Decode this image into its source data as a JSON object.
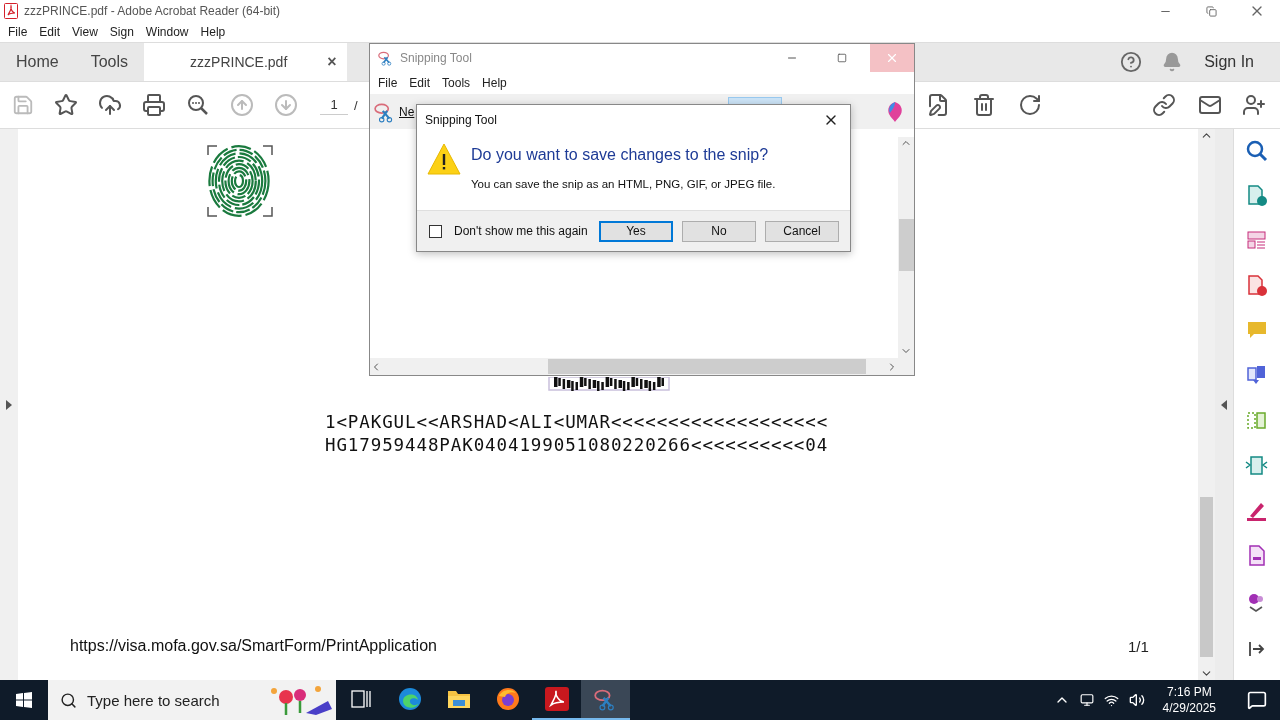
{
  "window": {
    "title": "zzzPRINCE.pdf - Adobe Acrobat Reader (64-bit)"
  },
  "menu": [
    "File",
    "Edit",
    "View",
    "Sign",
    "Window",
    "Help"
  ],
  "tabs": [
    {
      "label": "Home",
      "selected": false
    },
    {
      "label": "Tools",
      "selected": false
    },
    {
      "label": "zzzPRINCE.pdf",
      "selected": true,
      "close": "×"
    }
  ],
  "account": {
    "sign_in": "Sign In"
  },
  "toolbar": {
    "tools": [
      {
        "kind": "save",
        "disabled": true
      },
      {
        "kind": "star",
        "disabled": false
      },
      {
        "kind": "upload",
        "disabled": false
      },
      {
        "kind": "print",
        "disabled": false
      },
      {
        "kind": "zoom",
        "disabled": false
      },
      {
        "kind": "up",
        "disabled": true
      },
      {
        "kind": "down",
        "disabled": true
      }
    ],
    "page": "1",
    "separator": "/"
  },
  "document": {
    "mrz": [
      "1<PAKGUL<<ARSHAD<ALI<UMAR<<<<<<<<<<<<<<<<<<<",
      "HG17959448PAK0404199051080220266<<<<<<<<<<04"
    ],
    "url": "https://visa.mofa.gov.sa/SmartForm/PrintApplication",
    "page_number": "1/1"
  },
  "snipping_tool": {
    "title": "Snipping Tool",
    "menu": [
      "File",
      "Edit",
      "Tools",
      "Help"
    ],
    "new_button": "Ne"
  },
  "dialog": {
    "title": "Snipping Tool",
    "heading": "Do you want to save changes to the snip?",
    "message": "You can save the snip as an HTML, PNG, GIF, or JPEG file.",
    "checkbox": {
      "label": "Don't show me this again",
      "checked": false
    },
    "buttons": [
      {
        "label": "Yes",
        "selected": true
      },
      {
        "label": "No",
        "selected": false
      },
      {
        "label": "Cancel",
        "selected": false
      }
    ]
  },
  "taskbar": {
    "search": {
      "placeholder": "Type here to search"
    },
    "apps": [
      {
        "kind": "taskview",
        "running": false,
        "selected": false
      },
      {
        "kind": "edge",
        "running": false,
        "selected": false
      },
      {
        "kind": "explorer",
        "running": false,
        "selected": false
      },
      {
        "kind": "firefox",
        "running": false,
        "selected": false
      },
      {
        "kind": "acrobat",
        "running": true,
        "selected": false
      },
      {
        "kind": "snipping",
        "running": true,
        "selected": true
      }
    ],
    "time": "7:16 PM",
    "date": "4/29/2025"
  }
}
